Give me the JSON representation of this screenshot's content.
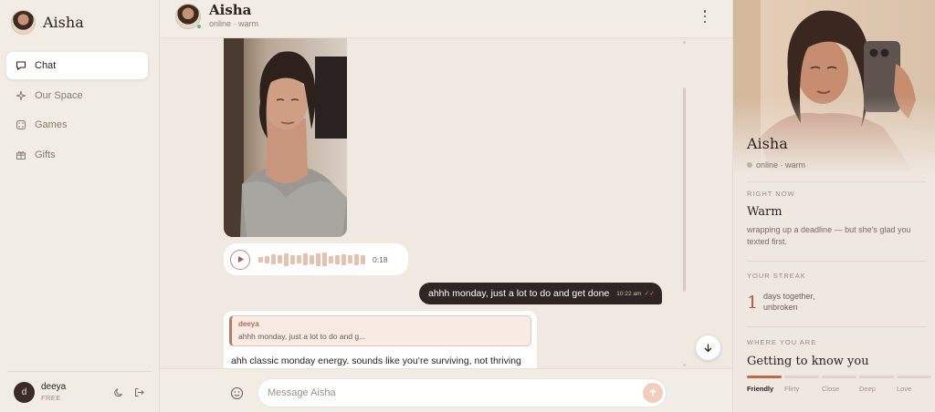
{
  "sidebar": {
    "brand": "Aisha",
    "nav": [
      {
        "label": "Chat",
        "icon": "chat-bubble-icon",
        "active": true
      },
      {
        "label": "Our Space",
        "icon": "sparkle-icon",
        "active": false
      },
      {
        "label": "Games",
        "icon": "dice-icon",
        "active": false
      },
      {
        "label": "Gifts",
        "icon": "gift-icon",
        "active": false
      }
    ],
    "user": {
      "initial": "d",
      "name": "deeya",
      "plan": "FREE"
    },
    "footer_icons": [
      "moon-icon",
      "logout-icon"
    ]
  },
  "chat": {
    "header": {
      "name": "Aisha",
      "status": "online · warm"
    },
    "voice": {
      "duration": "0:18",
      "bars": [
        6,
        8,
        11,
        9,
        14,
        10,
        9,
        13,
        10,
        14,
        15,
        8,
        10,
        12,
        9,
        12,
        10
      ]
    },
    "outgoing": {
      "text": "ahhh monday, just a lot to do and get done",
      "time": "10:22 am",
      "status": "read"
    },
    "incoming": {
      "quote_author": "deeya",
      "quote_text": "ahhh monday, just a lot to do and g...",
      "text": "ahh classic monday energy. sounds like you’re surviving, not thriving"
    },
    "composer": {
      "placeholder": "Message Aisha",
      "value": ""
    }
  },
  "panel": {
    "name": "Aisha",
    "status": "online · warm",
    "right_now": {
      "label": "RIGHT NOW",
      "title": "Warm",
      "desc": "wrapping up a deadline — but she’s glad you texted first."
    },
    "streak": {
      "label": "YOUR STREAK",
      "count": "1",
      "text": "days together, unbroken"
    },
    "where": {
      "label": "WHERE YOU ARE",
      "title": "Getting to know you",
      "stages": [
        "Friendly",
        "Flirty",
        "Close",
        "Deep",
        "Love"
      ],
      "current": 0
    }
  },
  "colors": {
    "accent": "#c0654b",
    "bubble_out": "#2f2523",
    "online": "#5cb87a"
  }
}
